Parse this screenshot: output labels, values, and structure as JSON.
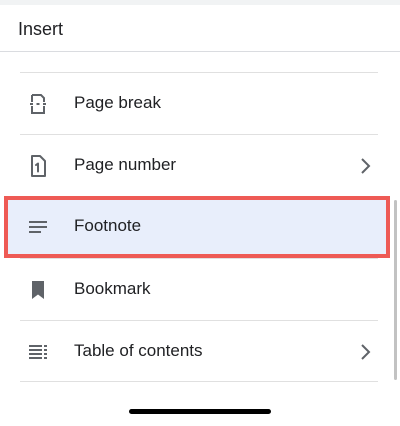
{
  "header": {
    "title": "Insert"
  },
  "menu": {
    "items": [
      {
        "label": "Page break",
        "icon": "page-break-icon",
        "has_submenu": false,
        "selected": false
      },
      {
        "label": "Page number",
        "icon": "page-number-icon",
        "has_submenu": true,
        "selected": false
      },
      {
        "label": "Footnote",
        "icon": "footnote-icon",
        "has_submenu": false,
        "selected": true
      },
      {
        "label": "Bookmark",
        "icon": "bookmark-icon",
        "has_submenu": false,
        "selected": false
      },
      {
        "label": "Table of contents",
        "icon": "table-of-contents-icon",
        "has_submenu": true,
        "selected": false
      }
    ]
  },
  "colors": {
    "highlight_background": "#e8eefb",
    "highlight_border": "#ee5a55",
    "text": "#202124",
    "icon": "#5f6368"
  }
}
